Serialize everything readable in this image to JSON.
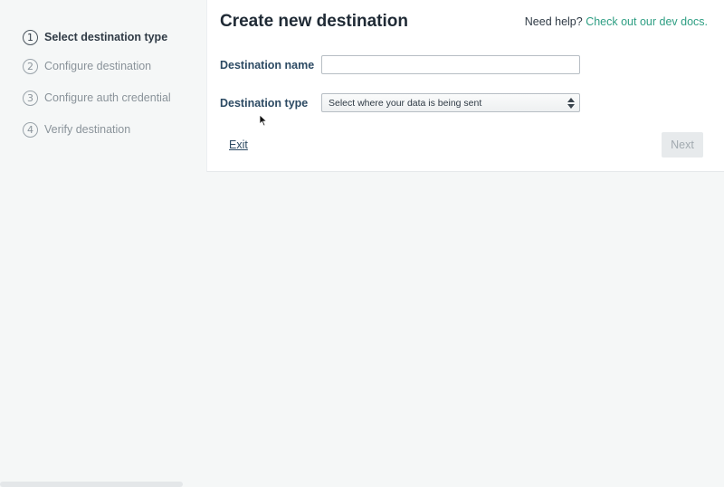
{
  "stepper": {
    "steps": [
      {
        "number": "1",
        "label": "Select destination type"
      },
      {
        "number": "2",
        "label": "Configure destination"
      },
      {
        "number": "3",
        "label": "Configure auth credential"
      },
      {
        "number": "4",
        "label": "Verify destination"
      }
    ],
    "active_step": 1
  },
  "header": {
    "title": "Create new destination",
    "help_text": "Need help?",
    "help_link": "Check out our dev docs."
  },
  "form": {
    "name_label": "Destination name",
    "name_value": "",
    "type_label": "Destination type",
    "type_selected": "Select where your data is being sent"
  },
  "actions": {
    "exit_label": "Exit",
    "next_label": "Next"
  },
  "colors": {
    "accent": "#2e9e83",
    "label": "#2c4a63",
    "disabled_bg": "#e7eaec",
    "disabled_text": "#a2aab0"
  }
}
